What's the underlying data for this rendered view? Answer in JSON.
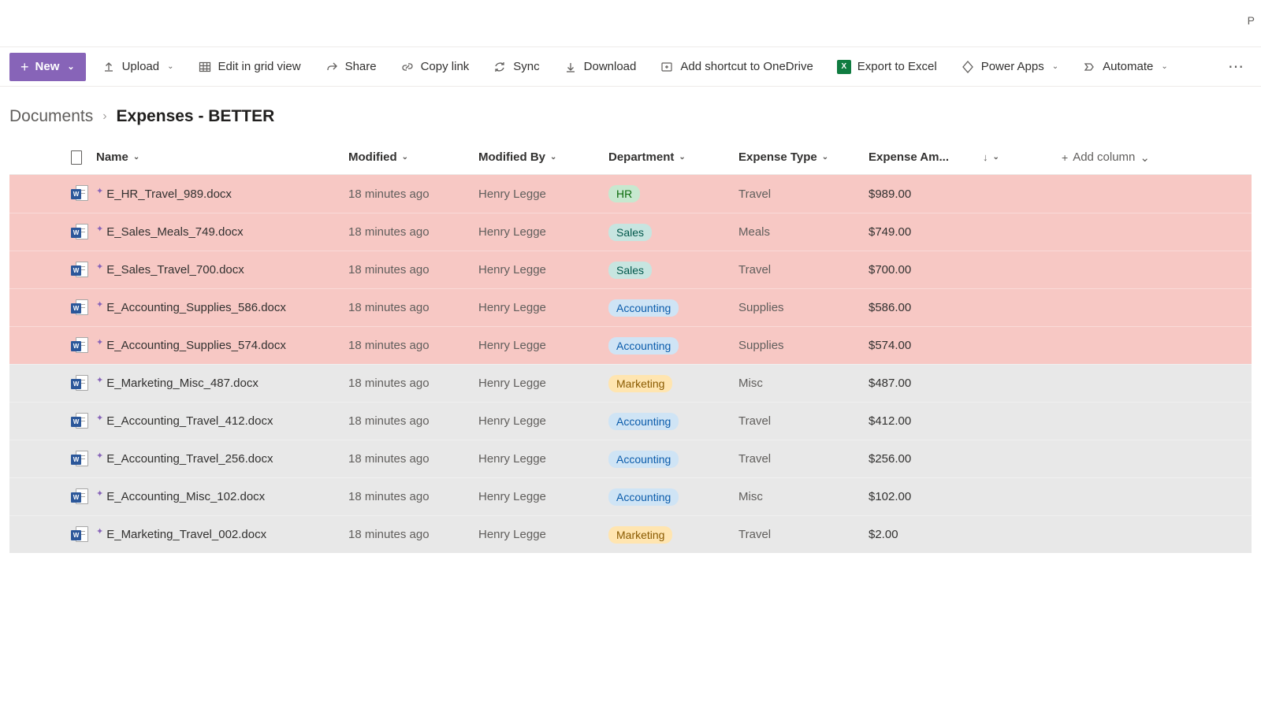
{
  "topbar": {
    "right_fragment": "P"
  },
  "commands": {
    "new": "New",
    "upload": "Upload",
    "edit_grid": "Edit in grid view",
    "share": "Share",
    "copy_link": "Copy link",
    "sync": "Sync",
    "download": "Download",
    "add_shortcut": "Add shortcut to OneDrive",
    "export_excel": "Export to Excel",
    "power_apps": "Power Apps",
    "automate": "Automate"
  },
  "breadcrumb": {
    "parent": "Documents",
    "current": "Expenses - BETTER"
  },
  "columns": {
    "name": "Name",
    "modified": "Modified",
    "modified_by": "Modified By",
    "department": "Department",
    "expense_type": "Expense Type",
    "expense_amount": "Expense Am...",
    "add_column": "Add column"
  },
  "rows": [
    {
      "name": "E_HR_Travel_989.docx",
      "modified": "18 minutes ago",
      "modified_by": "Henry Legge",
      "department": "HR",
      "expense_type": "Travel",
      "amount": "$989.00",
      "highlight": true
    },
    {
      "name": "E_Sales_Meals_749.docx",
      "modified": "18 minutes ago",
      "modified_by": "Henry Legge",
      "department": "Sales",
      "expense_type": "Meals",
      "amount": "$749.00",
      "highlight": true
    },
    {
      "name": "E_Sales_Travel_700.docx",
      "modified": "18 minutes ago",
      "modified_by": "Henry Legge",
      "department": "Sales",
      "expense_type": "Travel",
      "amount": "$700.00",
      "highlight": true
    },
    {
      "name": "E_Accounting_Supplies_586.docx",
      "modified": "18 minutes ago",
      "modified_by": "Henry Legge",
      "department": "Accounting",
      "expense_type": "Supplies",
      "amount": "$586.00",
      "highlight": true
    },
    {
      "name": "E_Accounting_Supplies_574.docx",
      "modified": "18 minutes ago",
      "modified_by": "Henry Legge",
      "department": "Accounting",
      "expense_type": "Supplies",
      "amount": "$574.00",
      "highlight": true
    },
    {
      "name": "E_Marketing_Misc_487.docx",
      "modified": "18 minutes ago",
      "modified_by": "Henry Legge",
      "department": "Marketing",
      "expense_type": "Misc",
      "amount": "$487.00",
      "highlight": false
    },
    {
      "name": "E_Accounting_Travel_412.docx",
      "modified": "18 minutes ago",
      "modified_by": "Henry Legge",
      "department": "Accounting",
      "expense_type": "Travel",
      "amount": "$412.00",
      "highlight": false
    },
    {
      "name": "E_Accounting_Travel_256.docx",
      "modified": "18 minutes ago",
      "modified_by": "Henry Legge",
      "department": "Accounting",
      "expense_type": "Travel",
      "amount": "$256.00",
      "highlight": false
    },
    {
      "name": "E_Accounting_Misc_102.docx",
      "modified": "18 minutes ago",
      "modified_by": "Henry Legge",
      "department": "Accounting",
      "expense_type": "Misc",
      "amount": "$102.00",
      "highlight": false
    },
    {
      "name": "E_Marketing_Travel_002.docx",
      "modified": "18 minutes ago",
      "modified_by": "Henry Legge",
      "department": "Marketing",
      "expense_type": "Travel",
      "amount": "$2.00",
      "highlight": false
    }
  ]
}
